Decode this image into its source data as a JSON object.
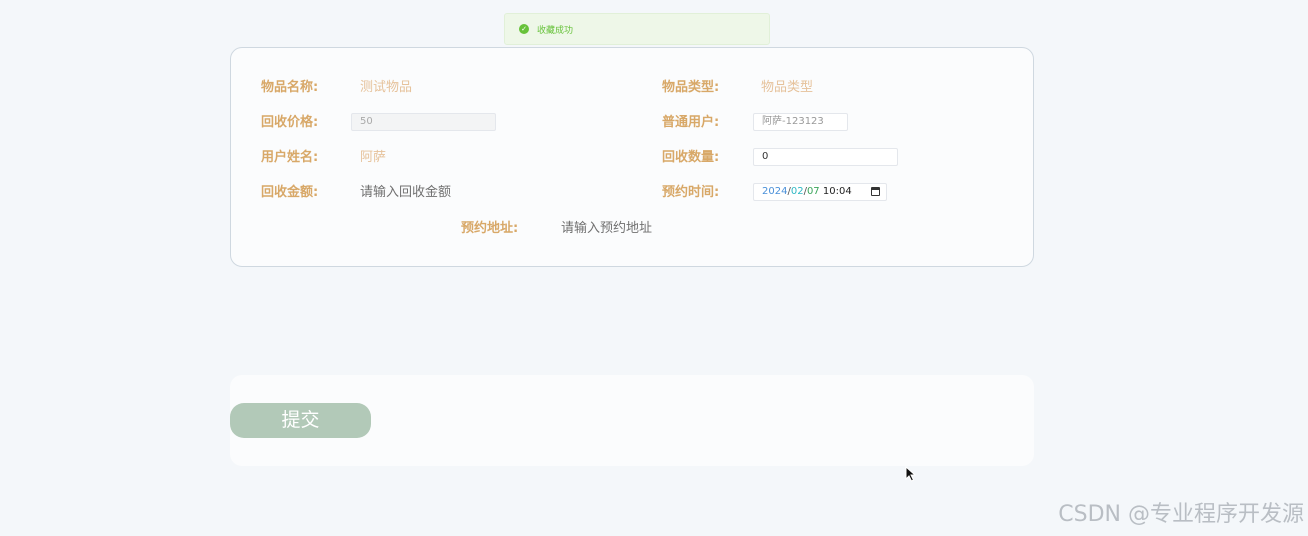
{
  "toast": {
    "icon": "check-circle-icon",
    "message": "收藏成功",
    "color": "#67c23a"
  },
  "form": {
    "item_name_label": "物品名称:",
    "item_name_value": "测试物品",
    "item_type_label": "物品类型:",
    "item_type_value": "物品类型",
    "price_label": "回收价格:",
    "price_value": "50",
    "user_label": "普通用户:",
    "user_value": "阿萨-123123",
    "username_label": "用户姓名:",
    "username_value": "阿萨",
    "quantity_label": "回收数量:",
    "quantity_value": "0",
    "amount_label": "回收金额:",
    "amount_placeholder": "请输入回收金额",
    "time_label": "预约时间:",
    "time_year": "2024",
    "time_month": "02",
    "time_day": "07",
    "time_clock": "10:04",
    "address_label": "预约地址:",
    "address_placeholder": "请输入预约地址"
  },
  "submit": {
    "label": "提交"
  },
  "watermark": "CSDN @专业程序开发源",
  "colors": {
    "label": "#d8a868",
    "value_peach": "#e6c29b",
    "submit_bg": "#b2c9b8",
    "background": "#f4f7fa"
  }
}
